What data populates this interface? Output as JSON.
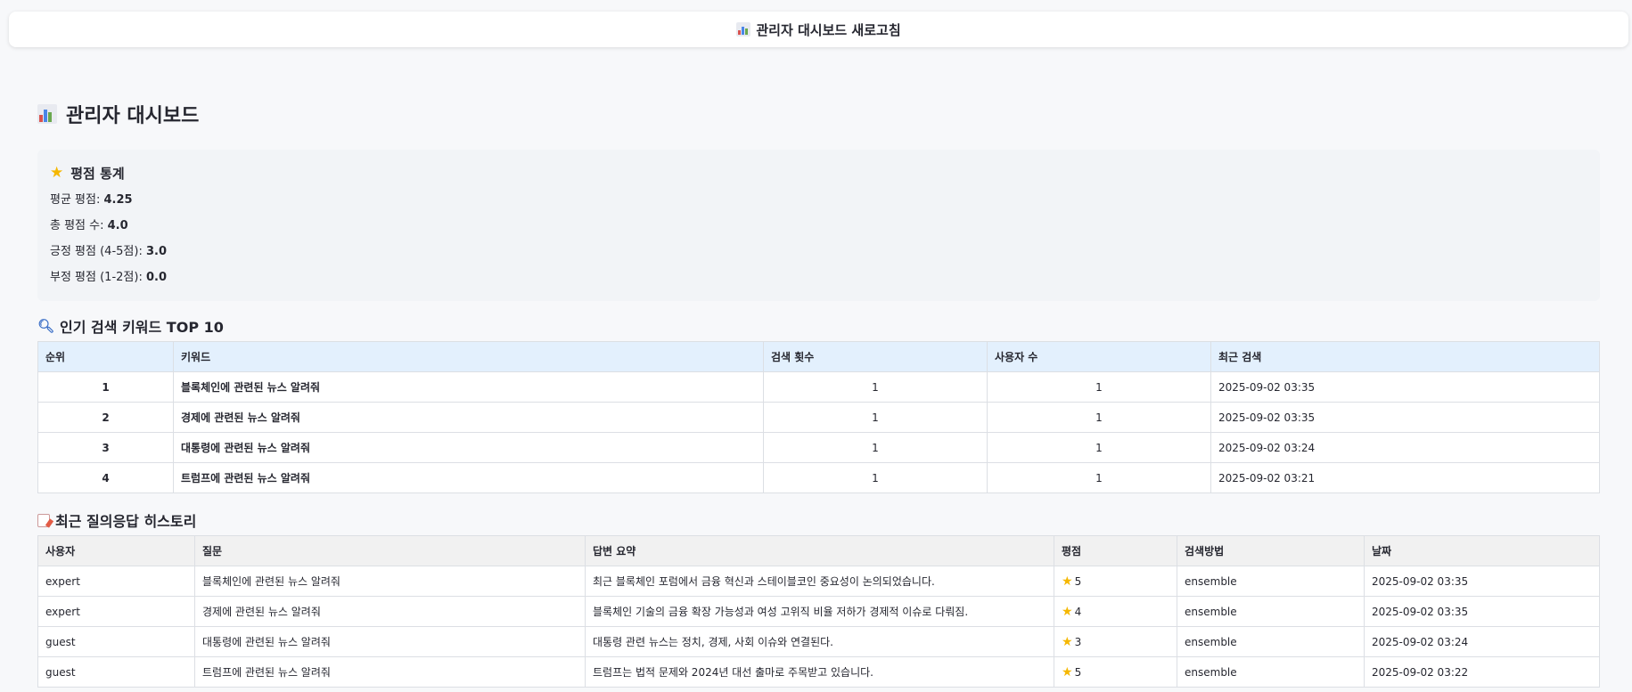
{
  "topbar": {
    "label": "관리자 대시보드 새로고침"
  },
  "page": {
    "title": "관리자 대시보드"
  },
  "rating_stats": {
    "title": "평점 통계",
    "items": [
      {
        "label": "평균 평점: ",
        "value": "4.25"
      },
      {
        "label": "총 평점 수: ",
        "value": "4.0"
      },
      {
        "label": "긍정 평점 (4-5점): ",
        "value": "3.0"
      },
      {
        "label": "부정 평점 (1-2점): ",
        "value": "0.0"
      }
    ]
  },
  "keywords": {
    "title": "인기 검색 키워드 TOP 10",
    "headers": [
      "순위",
      "키워드",
      "검색 횟수",
      "사용자 수",
      "최근 검색"
    ],
    "rows": [
      [
        "1",
        "블록체인에 관련된 뉴스 알려줘",
        "1",
        "1",
        "2025-09-02 03:35"
      ],
      [
        "2",
        "경제에 관련된 뉴스 알려줘",
        "1",
        "1",
        "2025-09-02 03:35"
      ],
      [
        "3",
        "대통령에 관련된 뉴스 알려줘",
        "1",
        "1",
        "2025-09-02 03:24"
      ],
      [
        "4",
        "트럼프에 관련된 뉴스 알려줘",
        "1",
        "1",
        "2025-09-02 03:21"
      ]
    ]
  },
  "history": {
    "title": "최근 질의응답 히스토리",
    "headers": [
      "사용자",
      "질문",
      "답변 요약",
      "평점",
      "검색방법",
      "날짜"
    ],
    "rows": [
      [
        "expert",
        "블록체인에 관련된 뉴스 알려줘",
        "최근 블록체인 포럼에서 금융 혁신과 스테이블코인 중요성이 논의되었습니다.",
        "5",
        "ensemble",
        "2025-09-02 03:35"
      ],
      [
        "expert",
        "경제에 관련된 뉴스 알려줘",
        "블록체인 기술의 금융 확장 가능성과 여성 고위직 비율 저하가 경제적 이슈로 다뤄짐.",
        "4",
        "ensemble",
        "2025-09-02 03:35"
      ],
      [
        "guest",
        "대통령에 관련된 뉴스 알려줘",
        "대통령 관련 뉴스는 정치, 경제, 사회 이슈와 연결된다.",
        "3",
        "ensemble",
        "2025-09-02 03:24"
      ],
      [
        "guest",
        "트럼프에 관련된 뉴스 알려줘",
        "트럼프는 법적 문제와 2024년 대선 출마로 주목받고 있습니다.",
        "5",
        "ensemble",
        "2025-09-02 03:22"
      ]
    ]
  },
  "colors": {
    "accent_star": "#f5b700",
    "keyword_header_bg": "#e3f0fd",
    "history_header_bg": "#f1f1f1"
  }
}
